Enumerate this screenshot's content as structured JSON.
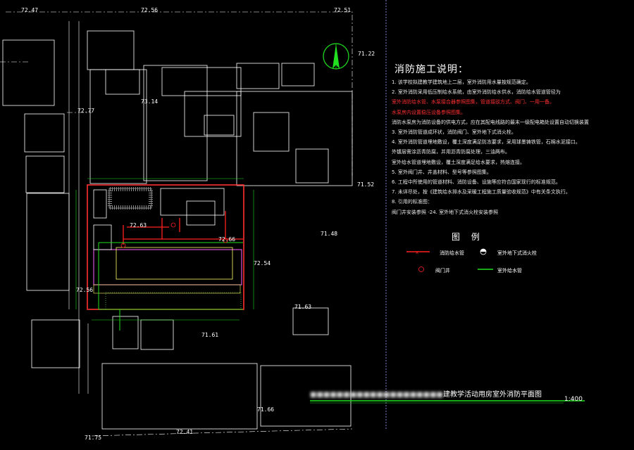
{
  "elevations": [
    {
      "text": "72.47"
    },
    {
      "text": "72.56"
    },
    {
      "text": "72.51"
    },
    {
      "text": "71.22"
    },
    {
      "text": "72.77"
    },
    {
      "text": "73.14"
    },
    {
      "text": "71.52"
    },
    {
      "text": "71.48"
    },
    {
      "text": "72.63"
    },
    {
      "text": "72.66"
    },
    {
      "text": "72.54"
    },
    {
      "text": "72.56"
    },
    {
      "text": "71.63"
    },
    {
      "text": "71.61"
    },
    {
      "text": "71.66"
    },
    {
      "text": "72.41"
    },
    {
      "text": "71.75"
    }
  ],
  "notes": {
    "title": "消防施工说明：",
    "lines": [
      {
        "text": "1.  该学校拟建教学建筑地上二层，室外消防用水量按规范确定。",
        "red": false
      },
      {
        "text": "2.  室外消防采用低压制给水系统，由室外消防给水供水，消防给水管道管径为",
        "red": false
      },
      {
        "text": "     室外消防给水管、水泵接合器参照图集，管道接驳方式、阀门、一用一备。",
        "red": true
      },
      {
        "text": "     水泵房内设置稳压设备参照图集。",
        "red": true
      },
      {
        "text": "     消防水泵房为消防设备的供电方式，应在其配电线路的最末一级配电箱处设置自动切换装置",
        "red": false
      },
      {
        "text": "3.  室外消防管道成环状，消防阀门、室外地下式消火栓。",
        "red": false
      },
      {
        "text": "4.  室外消防管道埋地敷设，覆土深度满足防冻要求，采用球墨铸铁管，石棉水泥接口。",
        "red": false
      },
      {
        "text": "     外镀层需涂沥青防腐，并用沥青防腐处理，三油两布。",
        "red": false
      },
      {
        "text": "     室外给水管道埋地敷设，覆土深度满足给水要求，热熔连接。",
        "red": false
      },
      {
        "text": "5.  室外阀门井、井盖材料、型号等参照图集。",
        "red": false
      },
      {
        "text": "6.  工程中所使用的管道材料、消防设备、设施等应符合国家现行的标准规范。",
        "red": false
      },
      {
        "text": "7.  未详尽处，按《建筑给水排水及采暖工程施工质量验收规范》中有关条文执行。",
        "red": false
      },
      {
        "text": "8.  引用的标准图：",
        "red": false
      },
      {
        "text": "     阀门井安装参照 -24.      室外地下式消火栓安装参照",
        "red": false
      }
    ]
  },
  "legend": {
    "title": "图 例",
    "items": [
      {
        "label": "消防给水管",
        "symbol": "red-line-x"
      },
      {
        "label": "室外地下式消火栓",
        "symbol": "hydrant"
      },
      {
        "label": "阀门井",
        "symbol": "valve-well"
      },
      {
        "label": "室外给水管",
        "symbol": "green-line"
      }
    ]
  },
  "title_block": {
    "drawing_title": "建教学活动用房室外消防平面图",
    "scale": "1:400"
  },
  "colors": {
    "background": "#000000",
    "fire_pipe": "#ff2020",
    "water_pipe": "#20e020",
    "outline": "#ffffff",
    "frame": "#00c0ff"
  }
}
